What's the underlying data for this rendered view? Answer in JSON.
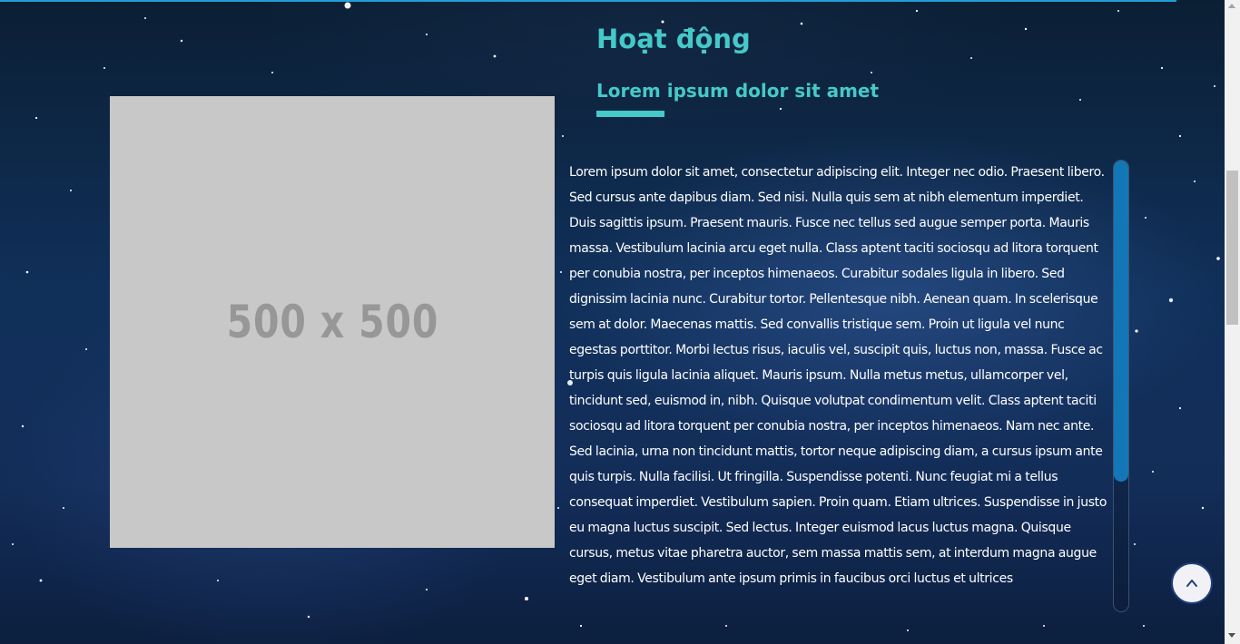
{
  "section": {
    "title": "Hoạt động",
    "subtitle": "Lorem ipsum dolor sit amet",
    "accent_color": "#45c9c9"
  },
  "image": {
    "placeholder_label": "500 x 500",
    "background_color": "#c8c8c8"
  },
  "body_text": "Lorem ipsum dolor sit amet, consectetur adipiscing elit. Integer nec odio. Praesent libero. Sed cursus ante dapibus diam. Sed nisi. Nulla quis sem at nibh elementum imperdiet. Duis sagittis ipsum. Praesent mauris. Fusce nec tellus sed augue semper porta. Mauris massa. Vestibulum lacinia arcu eget nulla. Class aptent taciti sociosqu ad litora torquent per conubia nostra, per inceptos himenaeos. Curabitur sodales ligula in libero. Sed dignissim lacinia nunc. Curabitur tortor. Pellentesque nibh. Aenean quam. In scelerisque sem at dolor. Maecenas mattis. Sed convallis tristique sem. Proin ut ligula vel nunc egestas porttitor. Morbi lectus risus, iaculis vel, suscipit quis, luctus non, massa. Fusce ac turpis quis ligula lacinia aliquet. Mauris ipsum. Nulla metus metus, ullamcorper vel, tincidunt sed, euismod in, nibh. Quisque volutpat condimentum velit. Class aptent taciti sociosqu ad litora torquent per conubia nostra, per inceptos himenaeos. Nam nec ante. Sed lacinia, urna non tincidunt mattis, tortor neque adipiscing diam, a cursus ipsum ante quis turpis. Nulla facilisi. Ut fringilla. Suspendisse potenti. Nunc feugiat mi a tellus consequat imperdiet. Vestibulum sapien. Proin quam. Etiam ultrices. Suspendisse in justo eu magna luctus suscipit. Sed lectus. Integer euismod lacus luctus magna. Quisque cursus, metus vitae pharetra auctor, sem massa mattis sem, at interdum magna augue eget diam. Vestibulum ante ipsum primis in faucibus orci luctus et ultrices",
  "text_scroll": {
    "thumb_color": "#1377b7"
  },
  "scroll_top_button": {
    "icon": "chevron-up-icon"
  },
  "theme": {
    "background": "starry-night-sky",
    "top_line_color": "#1e9fd8"
  }
}
